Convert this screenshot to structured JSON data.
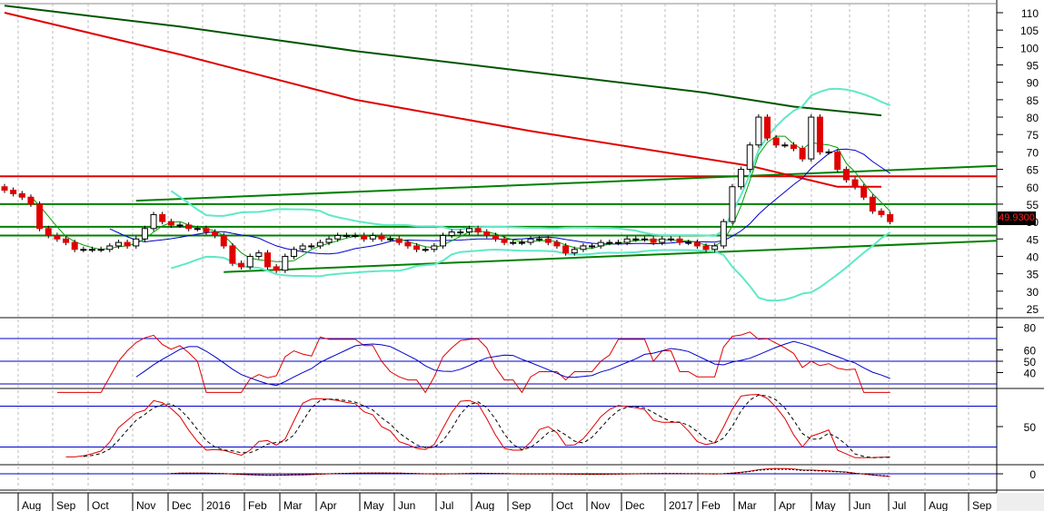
{
  "chart_data": {
    "type": "candlestick",
    "title": "",
    "price_axis": {
      "ticks": [
        110,
        105,
        100,
        95,
        90,
        85,
        80,
        75,
        70,
        65,
        60,
        55,
        50,
        45,
        40,
        35,
        30,
        25
      ],
      "range": [
        23,
        112
      ]
    },
    "last_price_label": "49.9300",
    "x_tick_labels": [
      "Aug",
      "Sep",
      "Oct",
      "Nov",
      "Dec",
      "2016",
      "Feb",
      "Mar",
      "Apr",
      "May",
      "Jun",
      "Jul",
      "Aug",
      "Sep",
      "Oct",
      "Nov",
      "Dec",
      "2017",
      "Feb",
      "Mar",
      "Apr",
      "May",
      "Jun",
      "Jul",
      "Aug",
      "Sep"
    ],
    "weekly_closes": [
      59,
      58,
      57,
      55,
      48,
      46,
      45,
      44,
      42,
      42,
      42,
      42,
      43,
      44,
      43,
      45,
      48,
      52,
      50,
      49,
      49,
      48,
      48,
      47,
      46,
      43,
      38,
      37,
      40,
      41,
      37,
      36,
      40,
      42,
      43,
      43,
      44,
      45,
      46,
      46,
      46,
      45,
      46,
      45,
      45,
      44,
      43,
      42,
      42,
      43,
      46,
      47,
      47,
      48,
      47,
      46,
      45,
      44,
      44,
      44,
      45,
      45,
      44,
      43,
      41,
      42,
      43,
      43,
      44,
      44,
      44,
      45,
      45,
      45,
      44,
      45,
      45,
      44,
      44,
      43,
      42,
      43,
      50,
      60,
      65,
      72,
      80,
      74,
      72,
      72,
      71,
      68,
      80,
      70,
      70,
      65,
      62,
      60,
      57,
      53,
      52,
      50
    ],
    "long_ma_red": {
      "name": "MA long (red)",
      "points_week_price": [
        [
          0,
          110
        ],
        [
          20,
          98
        ],
        [
          40,
          85
        ],
        [
          60,
          76
        ],
        [
          75,
          70
        ],
        [
          85,
          66
        ],
        [
          95,
          60
        ],
        [
          100,
          60
        ]
      ]
    },
    "long_ma_green": {
      "name": "MA long (green)",
      "points_week_price": [
        [
          0,
          112
        ],
        [
          20,
          106
        ],
        [
          40,
          99
        ],
        [
          60,
          93
        ],
        [
          80,
          87
        ],
        [
          90,
          83
        ],
        [
          100,
          80.5
        ]
      ]
    },
    "horizontal_levels": {
      "red": [
        63
      ],
      "green": [
        55,
        48.5,
        46
      ]
    },
    "trendlines": [
      {
        "from_week_price": [
          15,
          56
        ],
        "to_week_price": [
          115,
          66
        ]
      },
      {
        "from_week_price": [
          25,
          35.5
        ],
        "to_week_price": [
          115,
          44.5
        ]
      }
    ],
    "rsi_panel": {
      "ticks": [
        80,
        60,
        50,
        40
      ],
      "levels": [
        70,
        50,
        30
      ]
    },
    "stoch_panel": {
      "ticks": [
        50
      ],
      "levels": [
        80,
        20
      ]
    },
    "macd_panel": {
      "ticks": [
        0
      ]
    }
  },
  "colors": {
    "up": "#ffffff",
    "down": "#e00000",
    "ma_short": "#00a000",
    "ma_mid": "#0000cc",
    "bands": "#60e8c8",
    "red": "#e00000",
    "green": "#008000",
    "dkgreen": "#005500"
  }
}
